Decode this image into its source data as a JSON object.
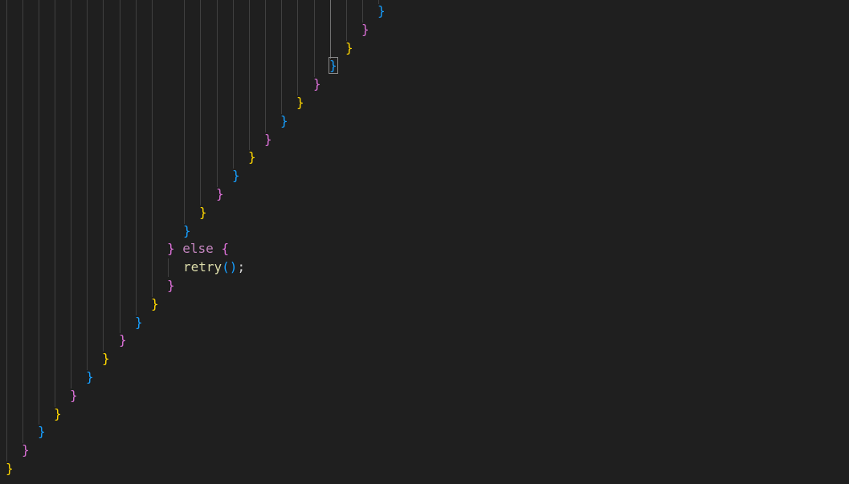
{
  "editor": {
    "language": "code",
    "colors": {
      "background": "#1f1f1f",
      "bracket_gold": "#ffd700",
      "bracket_orchid": "#da70d6",
      "bracket_blue": "#179fff",
      "keyword": "#c586c0",
      "function": "#dcdcaa",
      "text": "#d4d4d4"
    },
    "lines": [
      {
        "n": 0,
        "indent": 47,
        "tokens": [
          {
            "text": "}",
            "kind": "bracket-blue"
          }
        ]
      },
      {
        "n": 1,
        "indent": 45,
        "tokens": [
          {
            "text": "}",
            "kind": "bracket-orchid"
          }
        ]
      },
      {
        "n": 2,
        "indent": 43,
        "tokens": [
          {
            "text": "}",
            "kind": "bracket-gold"
          }
        ]
      },
      {
        "n": 3,
        "indent": 41,
        "tokens": [
          {
            "text": "}",
            "kind": "bracket-blue",
            "match": true
          }
        ]
      },
      {
        "n": 4,
        "indent": 39,
        "tokens": [
          {
            "text": "}",
            "kind": "bracket-orchid"
          }
        ]
      },
      {
        "n": 5,
        "indent": 37,
        "tokens": [
          {
            "text": "}",
            "kind": "bracket-gold"
          }
        ]
      },
      {
        "n": 6,
        "indent": 35,
        "tokens": [
          {
            "text": "}",
            "kind": "bracket-blue"
          }
        ]
      },
      {
        "n": 7,
        "indent": 33,
        "tokens": [
          {
            "text": "}",
            "kind": "bracket-orchid"
          }
        ]
      },
      {
        "n": 8,
        "indent": 31,
        "tokens": [
          {
            "text": "}",
            "kind": "bracket-gold"
          }
        ]
      },
      {
        "n": 9,
        "indent": 29,
        "tokens": [
          {
            "text": "}",
            "kind": "bracket-blue"
          }
        ]
      },
      {
        "n": 10,
        "indent": 27,
        "tokens": [
          {
            "text": "}",
            "kind": "bracket-orchid"
          }
        ]
      },
      {
        "n": 11,
        "indent": 25,
        "tokens": [
          {
            "text": "}",
            "kind": "bracket-gold"
          }
        ]
      },
      {
        "n": 12,
        "indent": 23,
        "tokens": [
          {
            "text": "}",
            "kind": "bracket-blue"
          }
        ]
      },
      {
        "n": 13,
        "indent": 21,
        "tokens": [
          {
            "text": "}",
            "kind": "bracket-orchid"
          },
          {
            "text": " ",
            "kind": "space"
          },
          {
            "text": "else",
            "kind": "keyword"
          },
          {
            "text": " ",
            "kind": "space"
          },
          {
            "text": "{",
            "kind": "bracket-orchid"
          }
        ]
      },
      {
        "n": 14,
        "indent": 23,
        "tokens": [
          {
            "text": "retry",
            "kind": "function"
          },
          {
            "text": "()",
            "kind": "bracket-blue"
          },
          {
            "text": ";",
            "kind": "text"
          }
        ]
      },
      {
        "n": 15,
        "indent": 21,
        "tokens": [
          {
            "text": "}",
            "kind": "bracket-orchid"
          }
        ]
      },
      {
        "n": 16,
        "indent": 19,
        "tokens": [
          {
            "text": "}",
            "kind": "bracket-gold"
          }
        ]
      },
      {
        "n": 17,
        "indent": 17,
        "tokens": [
          {
            "text": "}",
            "kind": "bracket-blue"
          }
        ]
      },
      {
        "n": 18,
        "indent": 15,
        "tokens": [
          {
            "text": "}",
            "kind": "bracket-orchid"
          }
        ]
      },
      {
        "n": 19,
        "indent": 13,
        "tokens": [
          {
            "text": "}",
            "kind": "bracket-gold"
          }
        ]
      },
      {
        "n": 20,
        "indent": 11,
        "tokens": [
          {
            "text": "}",
            "kind": "bracket-blue"
          }
        ]
      },
      {
        "n": 21,
        "indent": 9,
        "tokens": [
          {
            "text": "}",
            "kind": "bracket-orchid"
          }
        ]
      },
      {
        "n": 22,
        "indent": 7,
        "tokens": [
          {
            "text": "}",
            "kind": "bracket-gold"
          }
        ]
      },
      {
        "n": 23,
        "indent": 5,
        "tokens": [
          {
            "text": "}",
            "kind": "bracket-blue"
          }
        ]
      },
      {
        "n": 24,
        "indent": 3,
        "tokens": [
          {
            "text": "}",
            "kind": "bracket-orchid"
          }
        ]
      },
      {
        "n": 25,
        "indent": 1,
        "tokens": [
          {
            "text": "}",
            "kind": "bracket-gold"
          }
        ]
      }
    ]
  }
}
